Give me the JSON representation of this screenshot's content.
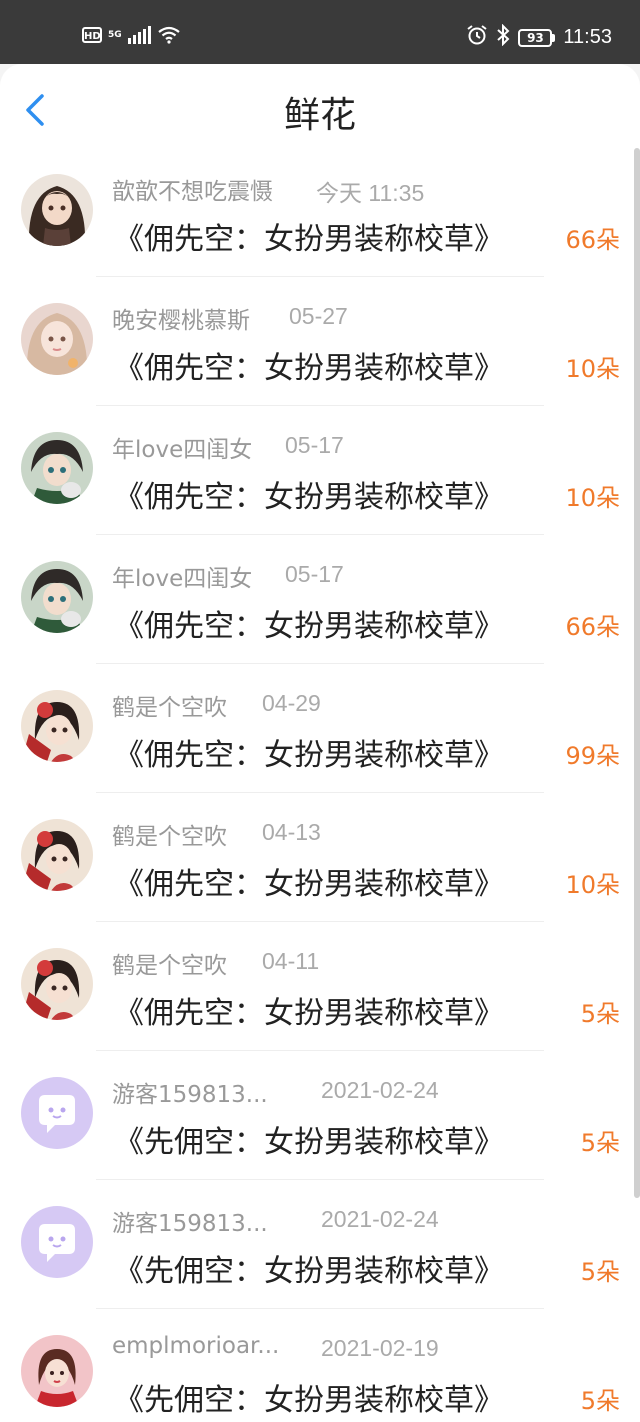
{
  "status_bar": {
    "hd": "HD",
    "network": "5G",
    "battery": "93",
    "time": "11:53"
  },
  "header": {
    "title": "鲜花",
    "back_icon": "chevron-left-icon"
  },
  "colors": {
    "accent_blue": "#2f8ff0",
    "amount_orange": "#f07a2b"
  },
  "items": [
    {
      "user": "歆歆不想吃震慑",
      "date": "今天 11:35",
      "book": "《佣先空：女扮男装称校草》",
      "amount": "66朵",
      "avatar": "girl-dark-hair"
    },
    {
      "user": "晚安樱桃慕斯",
      "date": "05-27",
      "book": "《佣先空：女扮男装称校草》",
      "amount": "10朵",
      "avatar": "girl-light-hair"
    },
    {
      "user": "年love四闺女",
      "date": "05-17",
      "book": "《佣先空：女扮男装称校草》",
      "amount": "10朵",
      "avatar": "boy-green"
    },
    {
      "user": "年love四闺女",
      "date": "05-17",
      "book": "《佣先空：女扮男装称校草》",
      "amount": "66朵",
      "avatar": "boy-green"
    },
    {
      "user": "鹤是个空吹",
      "date": "04-29",
      "book": "《佣先空：女扮男装称校草》",
      "amount": "99朵",
      "avatar": "girl-red-flower"
    },
    {
      "user": "鹤是个空吹",
      "date": "04-13",
      "book": "《佣先空：女扮男装称校草》",
      "amount": "10朵",
      "avatar": "girl-red-flower"
    },
    {
      "user": "鹤是个空吹",
      "date": "04-11",
      "book": "《佣先空：女扮男装称校草》",
      "amount": "5朵",
      "avatar": "girl-red-flower"
    },
    {
      "user": "游客159813...",
      "date": "2021-02-24",
      "book": "《先佣空：女扮男装称校草》",
      "amount": "5朵",
      "avatar": "guest-chat-bubble"
    },
    {
      "user": "游客159813...",
      "date": "2021-02-24",
      "book": "《先佣空：女扮男装称校草》",
      "amount": "5朵",
      "avatar": "guest-chat-bubble"
    },
    {
      "user": "emplmorioar...",
      "date": "2021-02-19",
      "book": "《先佣空：女扮男装称校草》",
      "amount": "5朵",
      "avatar": "girl-red-sweater"
    }
  ]
}
